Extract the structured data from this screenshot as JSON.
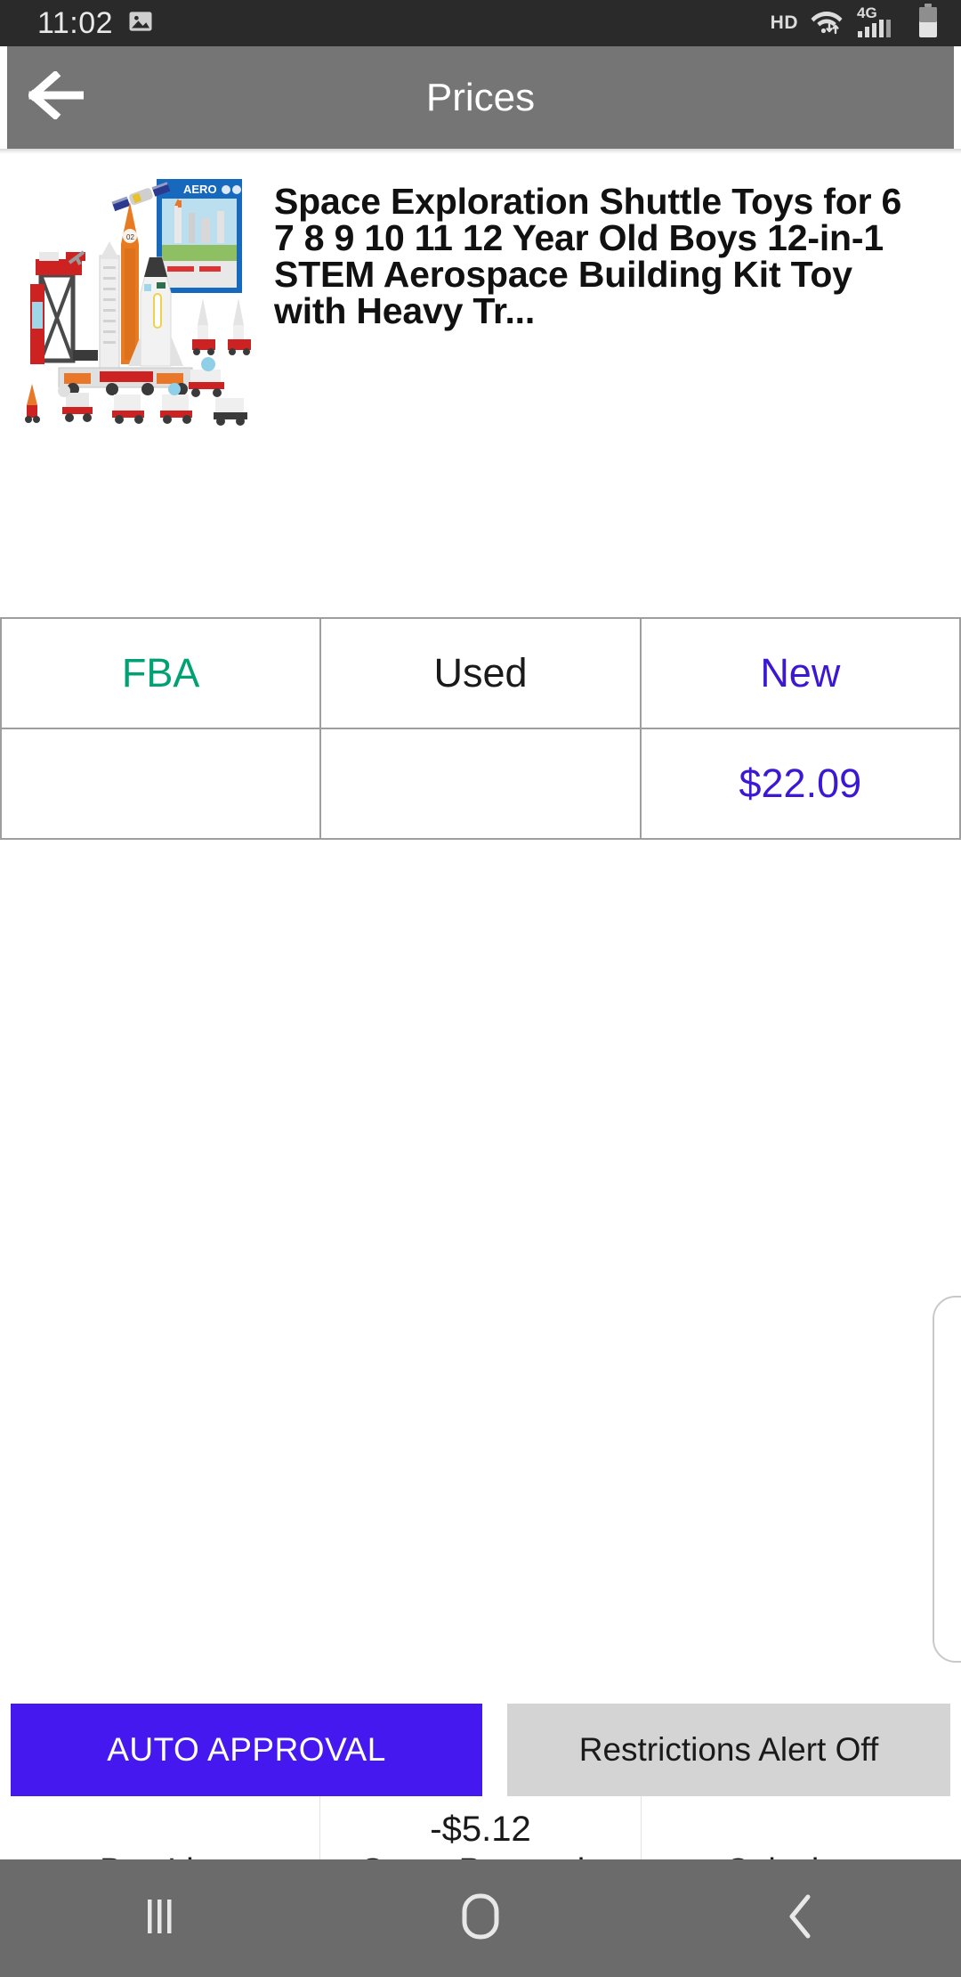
{
  "status_bar": {
    "time": "11:02",
    "photo_icon": "image-icon",
    "hd_label": "HD",
    "wifi_icon": "wifi-icon",
    "network_label": "4G",
    "signal_icon": "signal-bars-icon",
    "battery_icon": "battery-icon"
  },
  "app_bar": {
    "back_icon": "back-arrow-icon",
    "title": "Prices",
    "background": "#757575"
  },
  "product": {
    "image_alt": "space-exploration-shuttle-toy-set",
    "title": "Space Exploration Shuttle Toys for 6 7 8 9 10 11 12 Year Old Boys 12-in-1 STEM Aerospace Building Kit Toy with Heavy Tr..."
  },
  "price_table": {
    "headers": [
      "FBA",
      "Used",
      "New"
    ],
    "header_colors": [
      "#00a273",
      "#1a1a1a",
      "#3c17d4"
    ],
    "values": [
      "",
      "",
      "$22.09"
    ],
    "value_colors": [
      "#00a273",
      "#1a1a1a",
      "#3c17d4"
    ],
    "border_color": "#9e9e9e"
  },
  "actions": {
    "auto_approval_label": "AUTO APPROVAL",
    "auto_approval_color": "#4618f0",
    "restrictions_label": "Restrictions Alert Off",
    "restrictions_color": "#d4d4d4"
  },
  "tab_bar": {
    "tabs": [
      {
        "value": "",
        "label": "Buy List"
      },
      {
        "value": "-$5.12",
        "label": "Gross Proceeds"
      },
      {
        "value": "",
        "label": "Calculator"
      }
    ]
  },
  "nav_overlay": {
    "recents_icon": "recents-icon",
    "home_icon": "home-icon",
    "back_icon": "nav-back-icon",
    "background": "#6b6b6b"
  }
}
